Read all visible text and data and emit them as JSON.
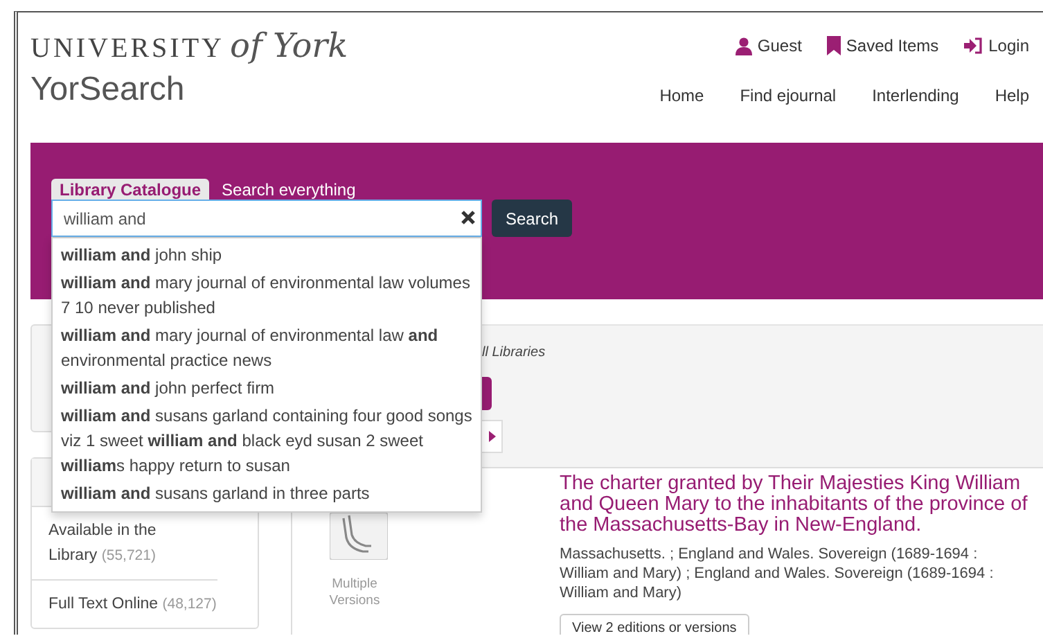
{
  "header": {
    "logo": {
      "word": "UNIVERSITY",
      "script": "of York"
    },
    "app_name": "YorSearch",
    "user_links": [
      {
        "label": "Guest"
      },
      {
        "label": "Saved Items"
      },
      {
        "label": "Login"
      }
    ],
    "nav": [
      "Home",
      "Find ejournal",
      "Interlending",
      "Help"
    ]
  },
  "search": {
    "tabs": [
      {
        "label": "Library Catalogue",
        "selected": true
      },
      {
        "label": "Search everything",
        "selected": false
      }
    ],
    "query": "william and",
    "button": "Search",
    "suggestions": [
      "**william and** john ship",
      "**william and** mary journal of environmental law volumes 7 10 never published",
      "**william and** mary journal of environmental law **and** environmental practice news",
      "**william and** john perfect firm",
      "**william and** susans garland containing four good songs viz 1 sweet **william and** black eyd susan 2 sweet **william**s happy return to susan",
      "**william and** susans garland in three parts"
    ]
  },
  "facets": [
    {
      "label": "Available in the Library",
      "count": "(55,721)"
    },
    {
      "label": "Full Text Online",
      "count": "(48,127)"
    }
  ],
  "scope": "ll Libraries",
  "result": {
    "format": "Multiple Versions",
    "title": "The charter granted by Their Majesties King William and Queen Mary to the inhabitants of the province of the Massachusetts-Bay in New-England.",
    "authors": "Massachusetts. ; England and Wales. Sovereign (1689-1694 : William and Mary) ; England and Wales. Sovereign (1689-1694 : William and Mary)",
    "versions_button": "View 2 editions or versions"
  }
}
